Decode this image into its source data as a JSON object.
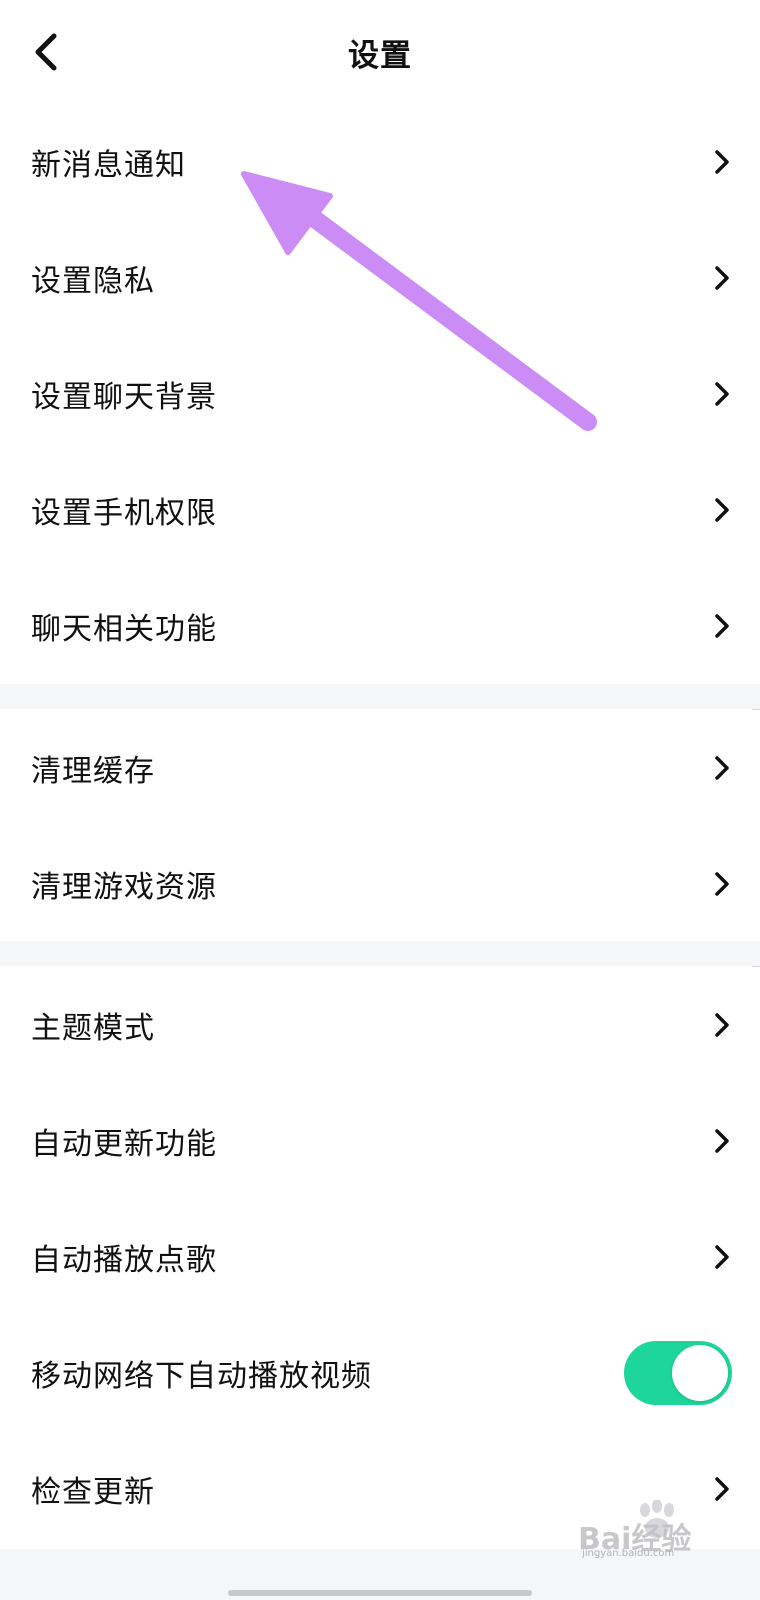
{
  "header": {
    "title": "设置"
  },
  "sections": [
    {
      "items": [
        {
          "label": "新消息通知"
        },
        {
          "label": "设置隐私"
        },
        {
          "label": "设置聊天背景"
        },
        {
          "label": "设置手机权限"
        },
        {
          "label": "聊天相关功能"
        }
      ]
    },
    {
      "items": [
        {
          "label": "清理缓存"
        },
        {
          "label": "清理游戏资源"
        }
      ]
    },
    {
      "items": [
        {
          "label": "主题模式"
        },
        {
          "label": "自动更新功能"
        },
        {
          "label": "自动播放点歌"
        },
        {
          "label": "移动网络下自动播放视频",
          "toggle_on": true
        },
        {
          "label": "检查更新"
        }
      ]
    }
  ],
  "colors": {
    "toggle_on": "#1ed69a",
    "annotation_arrow": "#cc8cf5",
    "section_gap": "#f5f6f8"
  },
  "icons": {
    "back": "chevron-left-icon",
    "row": "chevron-right-icon"
  },
  "watermark": {
    "brand": "Bai经验",
    "site": "jingyan.baidu.com"
  }
}
